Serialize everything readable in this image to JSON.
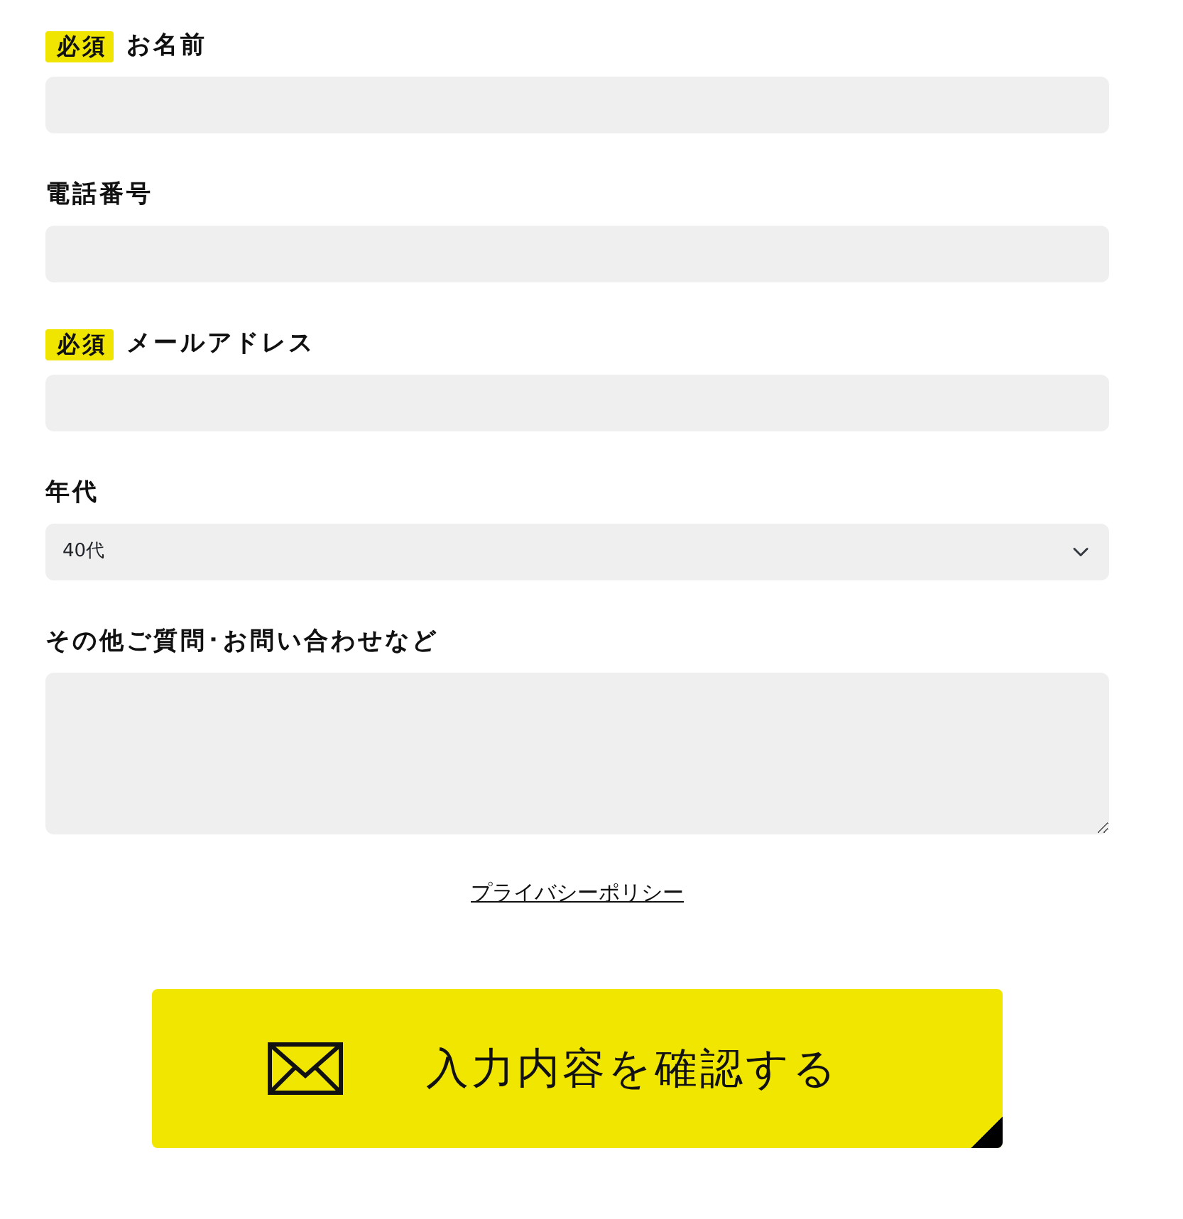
{
  "fields": [
    {
      "kind": "text",
      "label": "お名前",
      "required": true,
      "required_badge": "必須"
    },
    {
      "kind": "text",
      "label": "電話番号",
      "required": false
    },
    {
      "kind": "text",
      "label": "メールアドレス",
      "required": true,
      "required_badge": "必須"
    },
    {
      "kind": "select",
      "label": "年代",
      "value": "40代"
    },
    {
      "kind": "textarea",
      "label": "その他ご質問･お問い合わせなど"
    }
  ],
  "privacy_link": "プライバシーポリシー",
  "submit_button": "入力内容を確認する"
}
